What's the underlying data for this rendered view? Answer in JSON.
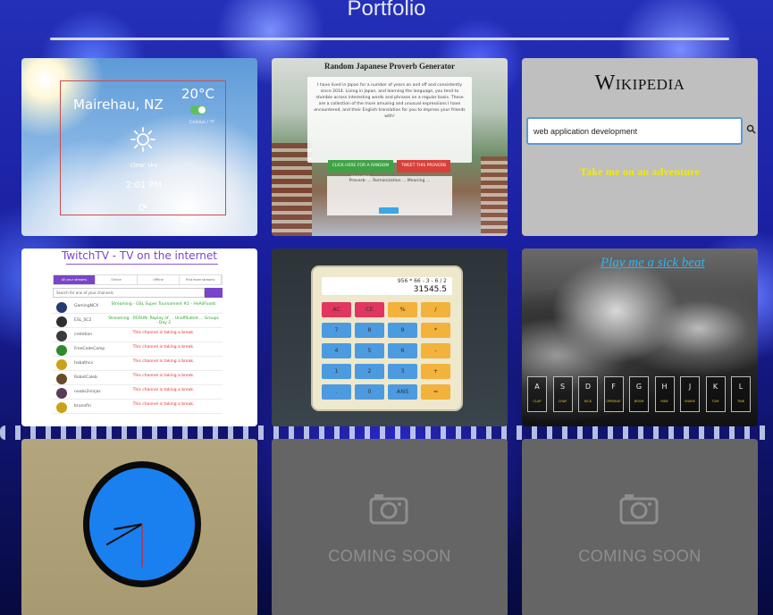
{
  "header": {
    "title": "Portfolio"
  },
  "projects": {
    "weather": {
      "city": "Mairehau, NZ",
      "temp": "20°C",
      "unit_caption": "Celsius / °F",
      "condition": "clear sky",
      "time": "2:01 PM",
      "icons": [
        "sun-icon",
        "refresh-icon"
      ]
    },
    "proverb": {
      "title": "Random Japanese Proverb Generator",
      "intro": "I have lived in Japan for a number of years on and off and consistently since 2014. Living in Japan, and learning the language, you tend to stumble across interesting words and phrases on a regular basis. These are a collection of the more amusing and unusual expressions I have encountered, and their English translation for you to impress your friends with!",
      "button_generate": "CLICK HERE FOR A RANDOM PROVERB",
      "button_tweet": "TWEET THIS PROVERB",
      "output": "Proverb: ...  Romanization ...  Meaning ..."
    },
    "wikipedia": {
      "logo": "Wikipedia",
      "search_value": "web application development",
      "adventure": "Take me on an adventure",
      "icons": [
        "search-icon"
      ]
    },
    "twitch": {
      "title": "TwitchTV - TV on the internet",
      "tabs": [
        "All your streams",
        "Online",
        "Offline",
        "Find more streams"
      ],
      "search_placeholder": "Search for one of your channels",
      "rows": [
        {
          "name": "GamingNCX",
          "status": "Streaming - GSL Super Tournament #2 - HeAdFoods",
          "color": "#2aa52a"
        },
        {
          "name": "ESL_SC2",
          "status": "Streaming - RERUN: Replay of ... Unaffiliated ... Groups - Day 2",
          "color": "#2aa52a"
        },
        {
          "name": "cretetion",
          "status": "This channel is taking a break.",
          "color": "#e2302a"
        },
        {
          "name": "FreeCodeCamp",
          "status": "This channel is taking a break.",
          "color": "#e2302a"
        },
        {
          "name": "habathcx",
          "status": "This channel is taking a break.",
          "color": "#e2302a"
        },
        {
          "name": "RobotCaleb",
          "status": "This channel is taking a break.",
          "color": "#e2302a"
        },
        {
          "name": "noobs2ninjas",
          "status": "This channel is taking a break.",
          "color": "#e2302a"
        },
        {
          "name": "brunofin",
          "status": "This channel is taking a break.",
          "color": "#e2302a"
        }
      ]
    },
    "calculator": {
      "expression": "956 * 66 - 3 - 6 / 2",
      "value": "31545.5",
      "buttons": [
        "AC",
        "CE",
        "%",
        "/",
        "7",
        "8",
        "9",
        "*",
        "4",
        "5",
        "6",
        "-",
        "1",
        "2",
        "3",
        "+",
        ".",
        "0",
        "ANS",
        "="
      ],
      "colors": {
        "ac_ce": "#e0365f",
        "op": "#f3b23c",
        "digit": "#4c9be0"
      }
    },
    "drum": {
      "title": "Play me a sick beat",
      "keys": [
        "A",
        "S",
        "D",
        "F",
        "G",
        "H",
        "J",
        "K",
        "L"
      ],
      "sounds": [
        "CLAP",
        "CHAP",
        "KICK",
        "OPENHAT",
        "BOOM",
        "RIDE",
        "SNARE",
        "TOM",
        "TINK"
      ]
    },
    "clock": {
      "hour": 8,
      "minute": 40,
      "second": 15
    },
    "coming_soon": [
      "COMING SOON",
      "COMING SOON"
    ]
  }
}
